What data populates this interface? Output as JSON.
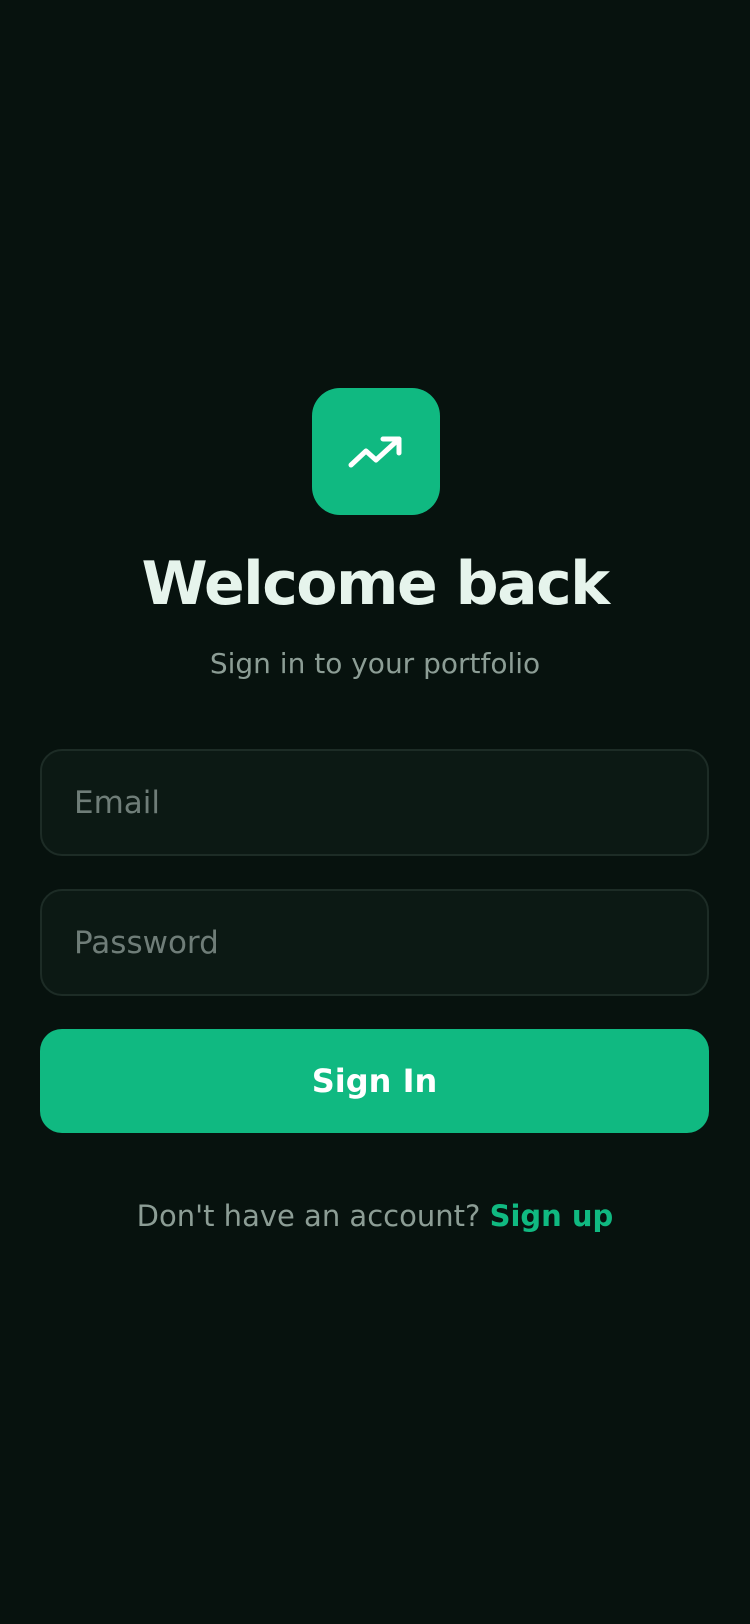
{
  "colors": {
    "background": "#07120e",
    "accent": "#10b981",
    "title": "#e6f4ec",
    "muted_text": "#8c9d95",
    "field_background": "#0c1914",
    "field_border": "#1d2c26",
    "placeholder": "#6f7d78",
    "button_text": "#ffffff"
  },
  "logo": {
    "icon": "trending-up-icon"
  },
  "header": {
    "title": "Welcome back",
    "subtitle": "Sign in to your portfolio"
  },
  "form": {
    "email": {
      "value": "",
      "placeholder": "Email"
    },
    "password": {
      "value": "",
      "placeholder": "Password"
    },
    "submit_label": "Sign In"
  },
  "footer": {
    "prompt": "Don't have an account?",
    "link_label": "Sign up"
  }
}
